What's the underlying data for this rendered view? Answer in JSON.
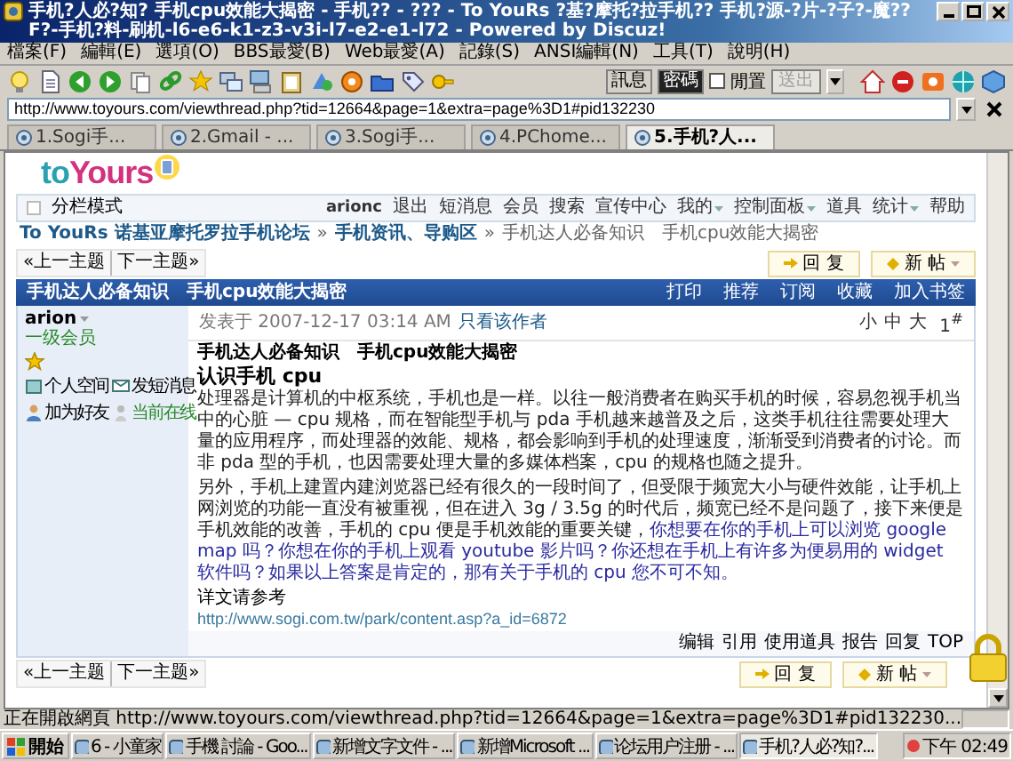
{
  "window": {
    "title": "手机?人必?知?  手机cpu效能大揭密 - 手机?? - ??? - To YouRs ?基?摩托?拉手机?? 手机?源-?片-?子?-魔??F?-手机?料-刷机-l6-e6-k1-z3-v3i-l7-e2-e1-l72 - Powered by Discuz!"
  },
  "menu": [
    "檔案(F)",
    "編輯(E)",
    "選項(O)",
    "BBS最愛(B)",
    "Web最愛(A)",
    "記錄(S)",
    "ANSI編輯(N)",
    "工具(T)",
    "說明(H)"
  ],
  "toolbar": {
    "buttons": [
      {
        "label": "訊息",
        "selected": false
      },
      {
        "label": "密碼",
        "selected": true
      }
    ],
    "idle": {
      "label": "閒置",
      "checked": false
    },
    "send": {
      "label": "送出",
      "disabled": true
    }
  },
  "address_bar": {
    "value": "http://www.toyours.com/viewthread.php?tid=12664&page=1&extra=page%3D1#pid132230"
  },
  "tabs": [
    {
      "label": "1.Sogi手...",
      "selected": false
    },
    {
      "label": "2.Gmail - ...",
      "selected": false
    },
    {
      "label": "3.Sogi手...",
      "selected": false
    },
    {
      "label": "4.PChome...",
      "selected": false
    },
    {
      "label": "5.手机?人...",
      "selected": true
    }
  ],
  "page": {
    "logo": [
      "to",
      "Yours"
    ],
    "navbar": {
      "split_mode": {
        "label": "分栏模式",
        "checked": false
      },
      "user": "arionc",
      "links": [
        {
          "label": "退出",
          "dropdown": false
        },
        {
          "label": "短消息",
          "dropdown": false
        },
        {
          "label": "会员",
          "dropdown": false
        },
        {
          "label": "搜索",
          "dropdown": false
        },
        {
          "label": "宣传中心",
          "dropdown": false
        },
        {
          "label": "我的",
          "dropdown": true
        },
        {
          "label": "控制面板",
          "dropdown": true
        },
        {
          "label": "道具",
          "dropdown": false
        },
        {
          "label": "统计",
          "dropdown": true
        },
        {
          "label": "帮助",
          "dropdown": false
        }
      ]
    },
    "breadcrumb": {
      "separator": "»",
      "items": [
        {
          "label": "To YouRs 诺基亚摩托罗拉手机论坛",
          "link": true
        },
        {
          "label": "手机资讯、导购区",
          "link": true
        },
        {
          "label": "手机达人必备知识　手机cpu效能大揭密",
          "link": false
        }
      ]
    },
    "thread_nav_top": {
      "prev": "«上一主题",
      "next": "下一主题»",
      "reply": "回 复",
      "new": "新 帖"
    },
    "thread_header": {
      "title": "手机达人必备知识　手机cpu效能大揭密",
      "links": [
        "打印",
        "推荐",
        "订阅",
        "收藏",
        "加入书签"
      ]
    },
    "post": {
      "author": {
        "name": "arion",
        "group": "一级会员",
        "links": [
          {
            "label": "个人空间",
            "kind": "space"
          },
          {
            "label": "发短消息",
            "kind": "message"
          },
          {
            "label": "加为好友",
            "kind": "friend"
          },
          {
            "label": "当前在线",
            "kind": "online"
          }
        ]
      },
      "posted": "发表于 2007-12-17 03:14 AM",
      "author_only": "只看该作者",
      "font_sizes": [
        "小",
        "中",
        "大"
      ],
      "floor": "1$^{#}$",
      "subject": "手机达人必备知识　手机cpu效能大揭密",
      "heading": "认识手机  cpu",
      "paragraphs": [
        [
          {
            "kind": "plain",
            "text": "处理器是计算机的中枢系统，手机也是一样。以往一般消费者在购买手机的时候，容易忽视手机当中的心脏 — cpu 规格，而在智能型手机与 pda 手机越来越普及之后，这类手机往往需要处理大量的应用程序，而处理器的效能、规格，都会影响到手机的处理速度，渐渐受到消费者的讨论。而非 pda 型的手机，也因需要处理大量的多媒体档案，cpu 的规格也随之提升。"
          }
        ],
        [
          {
            "kind": "plain",
            "text": "另外，手机上建置内建浏览器已经有很久的一段时间了，但受限于频宽大小与硬件效能，让手机上网浏览的功能一直没有被重视，但在进入 3g / 3.5g 的时代后，频宽已经不是问题了，接下来便是手机效能的改善，手机的 cpu 便是手机效能的重要关键，"
          },
          {
            "kind": "highlight",
            "text": "你想要在你的手机上可以浏览 google map 吗？你想在你的手机上观看 youtube 影片吗？你还想在手机上有许多为便易用的 widget 软件吗？如果以上答案是肯定的，那有关于手机的 cpu 您不可不知。"
          }
        ]
      ],
      "reference_label": "详文请参考",
      "reference_link": "http://www.sogi.com.tw/park/content.asp?a_id=6872",
      "actions": [
        "编辑",
        "引用",
        "使用道具",
        "报告",
        "回复",
        "TOP"
      ]
    },
    "thread_nav_bottom": {
      "prev": "«上一主题",
      "next": "下一主题»",
      "reply": "回 复",
      "new": "新 帖"
    }
  },
  "status_bar": {
    "text": "正在開啟網頁 http://www.toyours.com/viewthread.php?tid=12664&page=1&extra=page%3D1#pid132230..."
  },
  "taskbar": {
    "start": "開始",
    "items": [
      {
        "label": "6 - 小童家",
        "selected": false
      },
      {
        "label": "手機 討論 - Goo...",
        "selected": false
      },
      {
        "label": "新增文字文件 - ...",
        "selected": false
      },
      {
        "label": "新增Microsoft ...",
        "selected": false
      },
      {
        "label": "论坛用户注册 - ...",
        "selected": false
      },
      {
        "label": "手机?人必?知?...",
        "selected": true
      }
    ],
    "clock": "下午 02:49"
  }
}
